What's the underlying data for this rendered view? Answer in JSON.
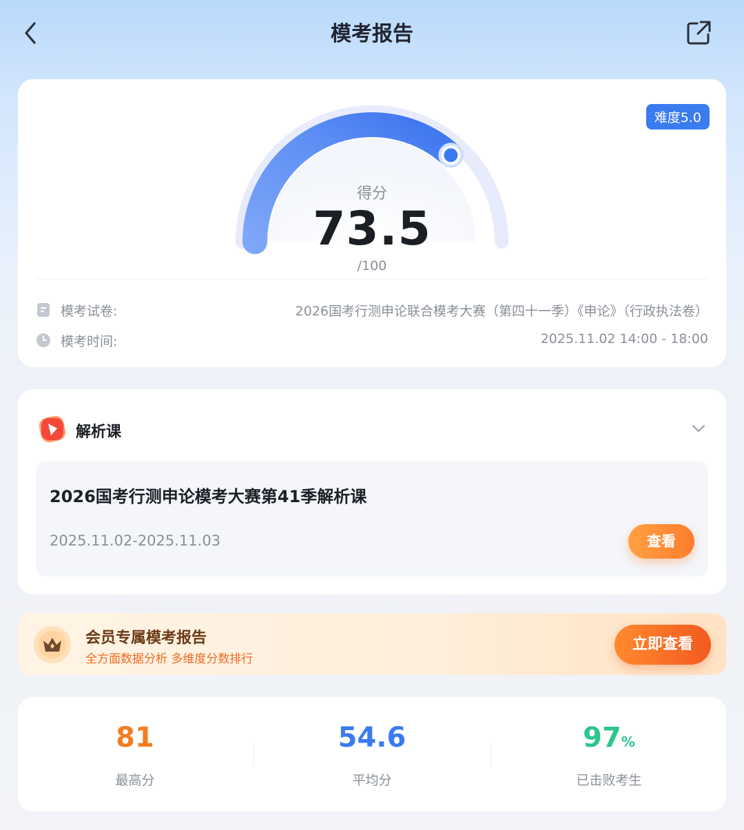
{
  "header": {
    "title": "模考报告"
  },
  "score_card": {
    "badge": "难度5.0",
    "score_label": "得分",
    "score": "73.5",
    "score_max": "/100",
    "score_fraction": 0.735,
    "paper_label": "模考试卷:",
    "paper_value": "2026国考行测申论联合模考大赛（第四十一季）《申论》（行政执法卷）",
    "time_label": "模考时间:",
    "time_value": "2025.11.02 14:00 - 18:00"
  },
  "course_section": {
    "title": "解析课",
    "course_title": "2026国考行测申论模考大赛第41季解析课",
    "course_date": "2025.11.02-2025.11.03",
    "view_button": "查看"
  },
  "vip_banner": {
    "title": "会员专属模考报告",
    "subtitle": "全方面数据分析 多维度分数排行",
    "button": "立即查看"
  },
  "stats": [
    {
      "value": "81",
      "unit": "",
      "label": "最高分",
      "color": "#f47d1f"
    },
    {
      "value": "54.6",
      "unit": "",
      "label": "平均分",
      "color": "#3a7bf0"
    },
    {
      "value": "97",
      "unit": "%",
      "label": "已击败考生",
      "color": "#2dc58c"
    }
  ],
  "colors": {
    "accent_blue": "#3a7bf0",
    "accent_orange": "#ff7c2e"
  }
}
